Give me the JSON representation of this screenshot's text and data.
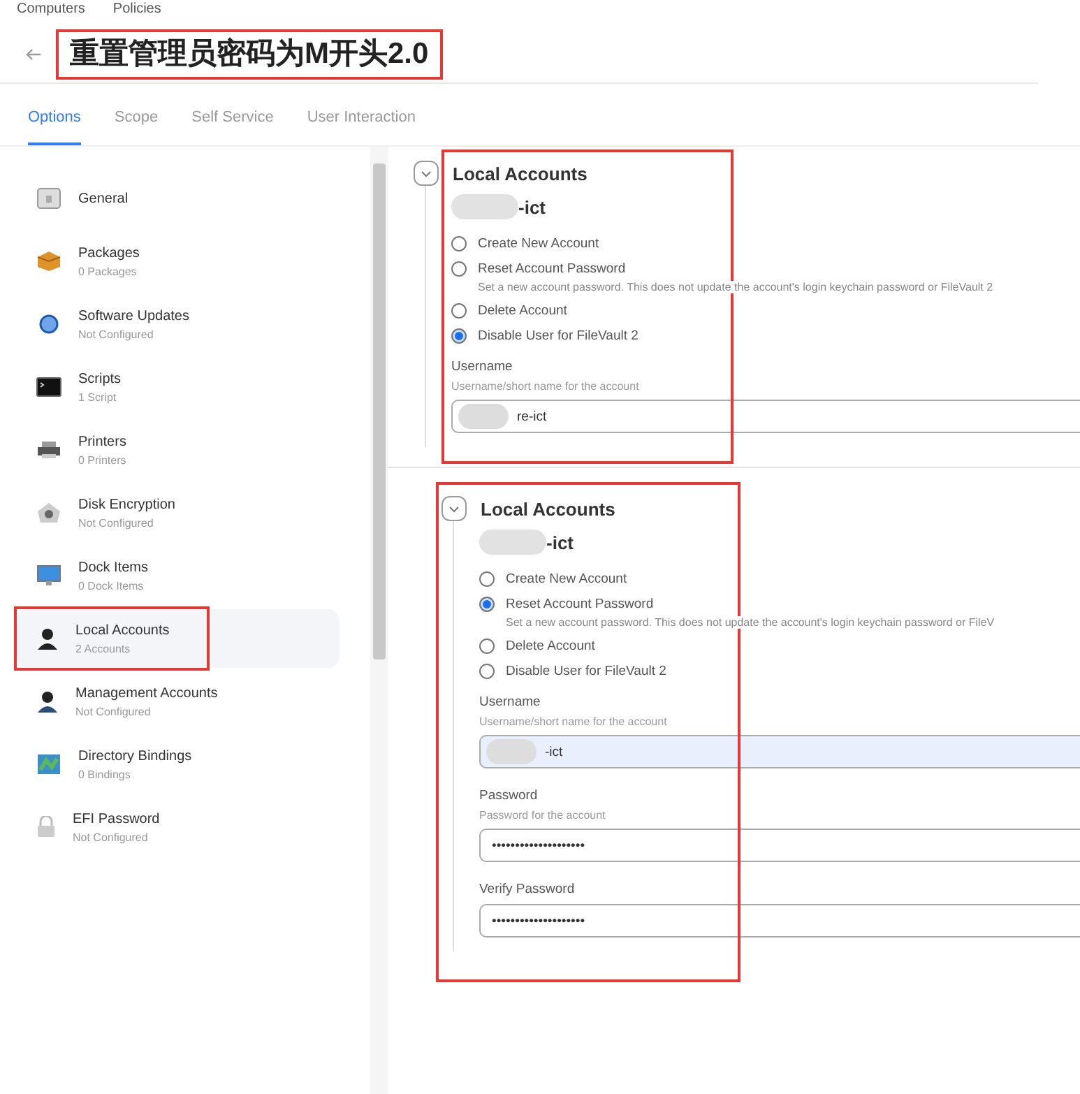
{
  "breadcrumb": [
    "Computers",
    "Policies"
  ],
  "title": "重置管理员密码为M开头2.0",
  "tabs": [
    {
      "label": "Options",
      "selected": true
    },
    {
      "label": "Scope",
      "selected": false
    },
    {
      "label": "Self Service",
      "selected": false
    },
    {
      "label": "User Interaction",
      "selected": false
    }
  ],
  "sidebar": {
    "items": [
      {
        "kind": "general",
        "label": "General",
        "selected": false
      },
      {
        "kind": "package",
        "label": "Packages",
        "subtitle": "0 Packages",
        "selected": false
      },
      {
        "kind": "update",
        "label": "Software Updates",
        "subtitle": "Not Configured",
        "selected": false
      },
      {
        "kind": "script",
        "label": "Scripts",
        "subtitle": "1 Script",
        "selected": false
      },
      {
        "kind": "printer",
        "label": "Printers",
        "subtitle": "0 Printers",
        "selected": false
      },
      {
        "kind": "disk",
        "label": "Disk Encryption",
        "subtitle": "Not Configured",
        "selected": false
      },
      {
        "kind": "dock",
        "label": "Dock Items",
        "subtitle": "0 Dock Items",
        "selected": false
      },
      {
        "kind": "user",
        "label": "Local Accounts",
        "subtitle": "2 Accounts",
        "selected": true
      },
      {
        "kind": "admin",
        "label": "Management Accounts",
        "subtitle": "Not Configured",
        "selected": false
      },
      {
        "kind": "binding",
        "label": "Directory Bindings",
        "subtitle": "0 Bindings",
        "selected": false
      },
      {
        "kind": "lock",
        "label": "EFI Password",
        "subtitle": "Not Configured",
        "selected": false
      }
    ]
  },
  "panels": [
    {
      "title": "Local Accounts",
      "account": "-ict",
      "options": [
        {
          "label": "Create New Account",
          "selected": false
        },
        {
          "label": "Reset Account Password",
          "description": "Set a new account password. This does not update the account's login keychain password or FileVault 2",
          "selected": false
        },
        {
          "label": "Delete Account",
          "selected": false
        },
        {
          "label": "Disable User for FileVault 2",
          "selected": true
        }
      ],
      "fields": [
        {
          "label": "Username",
          "hint": "Username/short name for the account",
          "value": "re-ict",
          "autofilled": false
        }
      ]
    },
    {
      "title": "Local Accounts",
      "account": "-ict",
      "options": [
        {
          "label": "Create New Account",
          "selected": false
        },
        {
          "label": "Reset Account Password",
          "description": "Set a new account password. This does not update the account's login keychain password or FileV",
          "selected": true
        },
        {
          "label": "Delete Account",
          "selected": false
        },
        {
          "label": "Disable User for FileVault 2",
          "selected": false
        }
      ],
      "fields": [
        {
          "label": "Username",
          "hint": "Username/short name for the account",
          "value": "-ict",
          "autofilled": true
        },
        {
          "label": "Password",
          "hint": "Password for the account",
          "value": "••••••••••••••••••••",
          "autofilled": false
        },
        {
          "label": "Verify Password",
          "value": "••••••••••••••••••••",
          "autofilled": false
        }
      ]
    }
  ]
}
